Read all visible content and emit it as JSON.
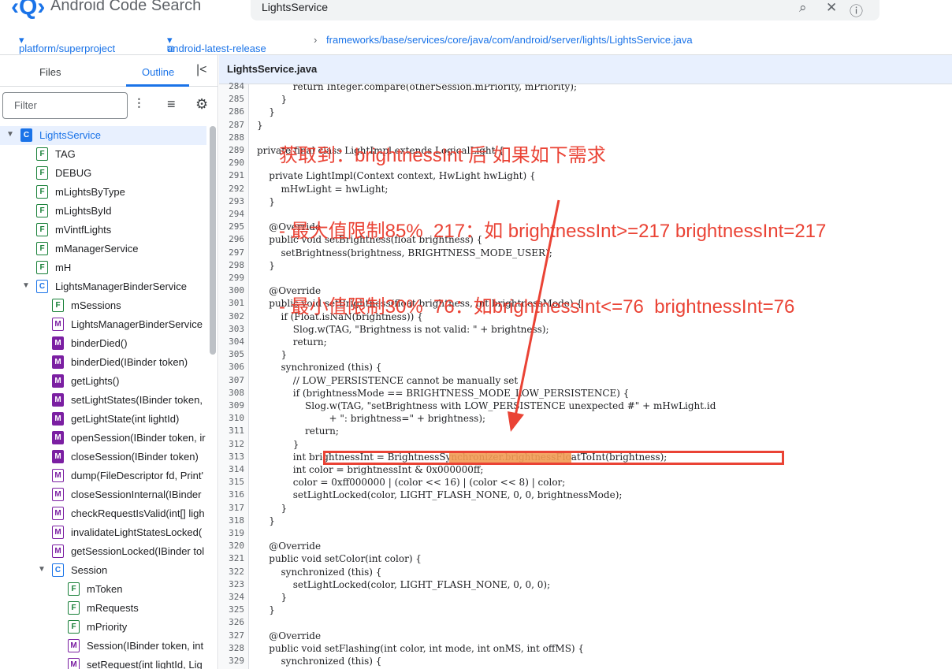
{
  "header": {
    "logo_glyph": "‹Q›",
    "brand": "Android Code Search",
    "search_value": "LightsService"
  },
  "breadcrumb": {
    "project": "platform/superproject",
    "branch": "android-latest-release",
    "path": "frameworks/base/services/core/java/com/android/server/lights/LightsService.java"
  },
  "left_panel": {
    "tab_files": "Files",
    "tab_outline": "Outline",
    "filter_placeholder": "Filter",
    "outline": [
      {
        "label": "LightsService",
        "badge": "C",
        "d": 0,
        "exp": true,
        "sel": true
      },
      {
        "label": "TAG",
        "badge": "F",
        "d": 1
      },
      {
        "label": "DEBUG",
        "badge": "F",
        "d": 1
      },
      {
        "label": "mLightsByType",
        "badge": "F",
        "d": 1
      },
      {
        "label": "mLightsById",
        "badge": "F",
        "d": 1
      },
      {
        "label": "mVintfLights",
        "badge": "F",
        "d": 1
      },
      {
        "label": "mManagerService",
        "badge": "F",
        "d": 1
      },
      {
        "label": "mH",
        "badge": "F",
        "d": 1
      },
      {
        "label": "LightsManagerBinderService",
        "badge": "C",
        "d": 1,
        "exp": true
      },
      {
        "label": "mSessions",
        "badge": "F",
        "d": 2
      },
      {
        "label": "LightsManagerBinderService",
        "badge": "Mo",
        "d": 2
      },
      {
        "label": "binderDied()",
        "badge": "M",
        "d": 2
      },
      {
        "label": "binderDied(IBinder token)",
        "badge": "M",
        "d": 2
      },
      {
        "label": "getLights()",
        "badge": "M",
        "d": 2
      },
      {
        "label": "setLightStates(IBinder token,",
        "badge": "M",
        "d": 2
      },
      {
        "label": "getLightState(int lightId)",
        "badge": "M",
        "d": 2
      },
      {
        "label": "openSession(IBinder token, ir",
        "badge": "M",
        "d": 2
      },
      {
        "label": "closeSession(IBinder token)",
        "badge": "M",
        "d": 2
      },
      {
        "label": "dump(FileDescriptor fd, Print'",
        "badge": "Mo",
        "d": 2
      },
      {
        "label": "closeSessionInternal(IBinder",
        "badge": "Mo",
        "d": 2
      },
      {
        "label": "checkRequestIsValid(int[] ligh",
        "badge": "Mo",
        "d": 2
      },
      {
        "label": "invalidateLightStatesLocked(",
        "badge": "Mo",
        "d": 2
      },
      {
        "label": "getSessionLocked(IBinder tol",
        "badge": "Mo",
        "d": 2
      },
      {
        "label": "Session",
        "badge": "C",
        "d": 2,
        "exp": true
      },
      {
        "label": "mToken",
        "badge": "F",
        "d": 3
      },
      {
        "label": "mRequests",
        "badge": "F",
        "d": 3
      },
      {
        "label": "mPriority",
        "badge": "F",
        "d": 3
      },
      {
        "label": "Session(IBinder token, int",
        "badge": "Mo",
        "d": 3
      },
      {
        "label": "setRequest(int lightId, Lig",
        "badge": "Mo",
        "d": 3
      }
    ]
  },
  "file_title": "LightsService.java",
  "code_start": 284,
  "code": [
    "            return Integer.compare(otherSession.mPriority, mPriority);",
    "        }",
    "    }",
    "}",
    "",
    "private final class LightImpl extends LogicalLight {",
    "",
    "    private LightImpl(Context context, HwLight hwLight) {",
    "        mHwLight = hwLight;",
    "    }",
    "",
    "    @Override",
    "    public void setBrightness(float brightness) {",
    "        setBrightness(brightness, BRIGHTNESS_MODE_USER);",
    "    }",
    "",
    "    @Override",
    "    public void setBrightness(float brightness, int brightnessMode) {",
    "        if (Float.isNaN(brightness)) {",
    "            Slog.w(TAG, \"Brightness is not valid: \" + brightness);",
    "            return;",
    "        }",
    "        synchronized (this) {",
    "            // LOW_PERSISTENCE cannot be manually set",
    "            if (brightnessMode == BRIGHTNESS_MODE_LOW_PERSISTENCE) {",
    "                Slog.w(TAG, \"setBrightness with LOW_PERSISTENCE unexpected #\" + mHwLight.id",
    "                        + \": brightness=\" + brightness);",
    "                return;",
    "            }",
    "            int brightnessInt = BrightnessSynchronizer.brightnessFloatToInt(brightness);",
    "            int color = brightnessInt & 0x000000ff;",
    "            color = 0xff000000 | (color << 16) | (color << 8) | color;",
    "            setLightLocked(color, LIGHT_FLASH_NONE, 0, 0, brightnessMode);",
    "        }",
    "    }",
    "",
    "    @Override",
    "    public void setColor(int color) {",
    "        synchronized (this) {",
    "            setLightLocked(color, LIGHT_FLASH_NONE, 0, 0, 0);",
    "        }",
    "    }",
    "",
    "    @Override",
    "    public void setFlashing(int color, int mode, int onMS, int offMS) {",
    "        synchronized (this) {"
  ],
  "annotation": [
    "获取到：brightnessInt 后 如果如下需求",
    "- 最大值限制85%  217：如 brightnessInt>=217 brightnessInt=217",
    "- 最小值限制30%  76：如brightnessInt<=76  brightnessInt=76"
  ]
}
